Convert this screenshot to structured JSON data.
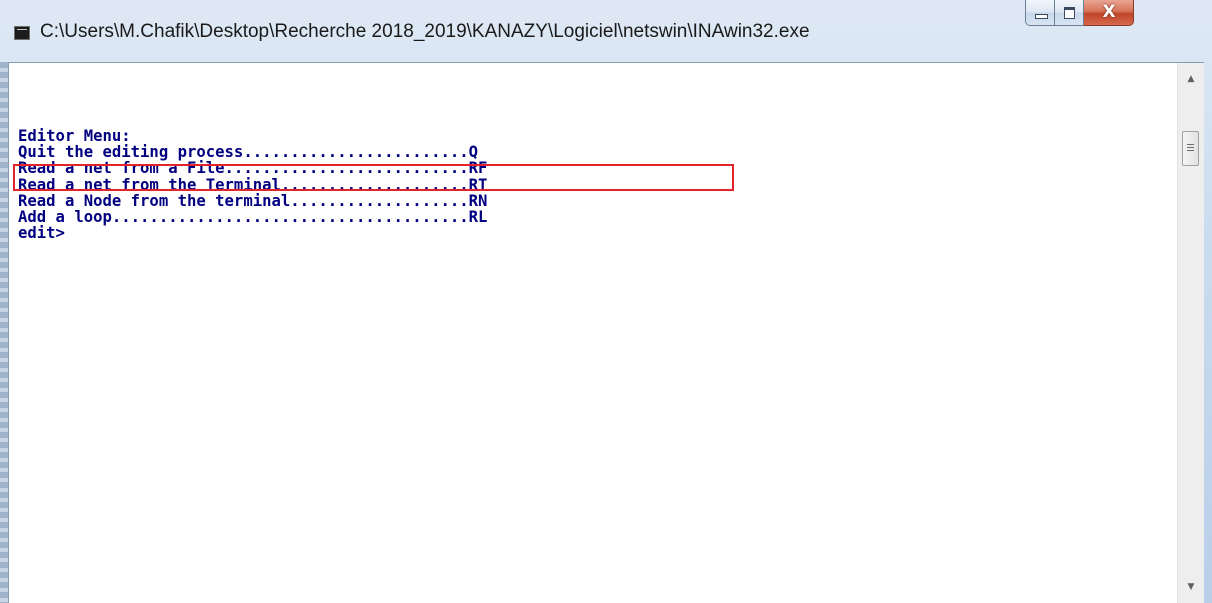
{
  "window": {
    "title": "C:\\Users\\M.Chafik\\Desktop\\Recherche 2018_2019\\KANAZY\\Logiciel\\netswin\\INAwin32.exe",
    "icon": "console-app-icon",
    "buttons": {
      "minimize": "minimize-icon",
      "maximize": "maximize-icon",
      "close_glyph": "X"
    }
  },
  "console": {
    "text_color": "#000080",
    "highlight_color": "#e3242b",
    "highlighted_line_index": 2,
    "lines": [
      "Editor Menu:",
      "Quit the editing process........................Q",
      "Read a net from a File..........................RF",
      "Read a net from the Terminal....................RT",
      "Read a Node from the terminal...................RN",
      "Add a loop......................................RL",
      "edit>"
    ]
  },
  "scrollbar": {
    "up_arrow": "▲",
    "down_arrow": "▼"
  }
}
